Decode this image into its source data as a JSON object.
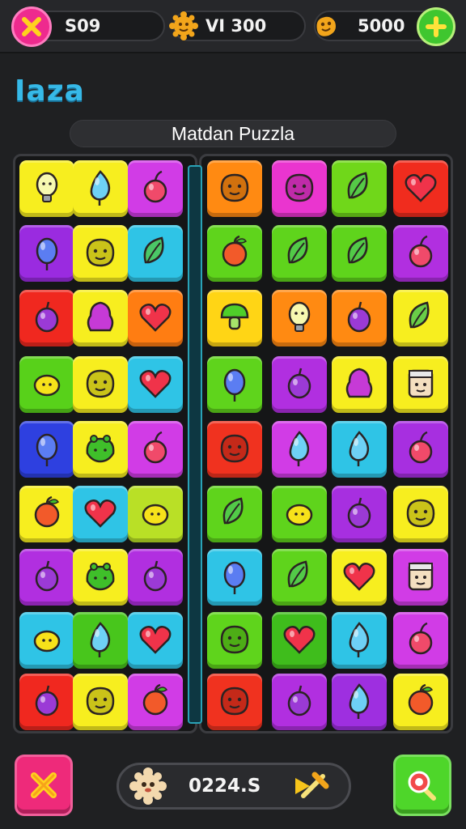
{
  "topbar": {
    "close_button_icon": "x-icon",
    "lives_value": "S09",
    "coins_icon": "sun-coin-icon",
    "coins_value": "VI 300",
    "gems_icon": "bean-icon",
    "gems_value": "5000",
    "add_button_icon": "plus-icon",
    "colors": {
      "close_bg": "#ee2a8e",
      "close_icon": "#ffd21e",
      "add_bg": "#3fc62f",
      "add_icon": "#ffe23a",
      "coin": "#f2a51b"
    }
  },
  "logo": "Іaza",
  "level_title": "Matdan Puzzla",
  "board": {
    "left_columns": 3,
    "right_columns": 4,
    "rows": 9,
    "tiles": [
      [
        "#f7ee1f",
        "#f7ee1f",
        "#d13ce6",
        "#ff8a12",
        "#ea35cf",
        "#70d71a",
        "#f02c1e"
      ],
      [
        "#9a2be0",
        "#f7ee1f",
        "#2fc4e6",
        "#5fd41c",
        "#5fd41c",
        "#5fd41c",
        "#b12fe0"
      ],
      [
        "#f0281f",
        "#f7ee1f",
        "#ff7d12",
        "#ffd515",
        "#ff8a12",
        "#ff8a12",
        "#f7ee1f"
      ],
      [
        "#58d11a",
        "#f7ee1f",
        "#2fc4e6",
        "#5fd41c",
        "#b12fe0",
        "#f7ee1f",
        "#f7ee1f"
      ],
      [
        "#2e40e0",
        "#f7ee1f",
        "#d13ce6",
        "#f0321f",
        "#d13ce6",
        "#2fc4e6",
        "#a72fe0"
      ],
      [
        "#f7ee1f",
        "#2fc4e6",
        "#b9e026",
        "#5fd41c",
        "#5fd41c",
        "#a72fe0",
        "#f7ee1f"
      ],
      [
        "#b12fe0",
        "#f7ee1f",
        "#b12fe0",
        "#2fc4e6",
        "#5fd41c",
        "#f7ee1f",
        "#d13ce6"
      ],
      [
        "#2fc4e6",
        "#48c61c",
        "#2fc4e6",
        "#5fd41c",
        "#3fbd1c",
        "#2fc4e6",
        "#d13ce6"
      ],
      [
        "#f0281f",
        "#f7ee1f",
        "#d13ce6",
        "#f0321f",
        "#b12fe0",
        "#9e2fe0",
        "#f7ee1f"
      ]
    ],
    "icons": [
      [
        "bulb-icon",
        "drop-icon",
        "cherry-icon",
        "face-icon",
        "face-icon",
        "leaf-icon",
        "heart-icon"
      ],
      [
        "balloon-icon",
        "face-icon",
        "leaf-icon",
        "apple-icon",
        "leaf-icon",
        "leaf-icon",
        "cherry-icon"
      ],
      [
        "plum-icon",
        "blob-icon",
        "heart-icon",
        "mushroom-icon",
        "bulb-icon",
        "plum-icon",
        "leaf-icon"
      ],
      [
        "lemon-icon",
        "face-icon",
        "heart-icon",
        "balloon-icon",
        "plum-icon",
        "blob-icon",
        "robot-icon"
      ],
      [
        "balloon-icon",
        "frog-icon",
        "cherry-icon",
        "face-icon",
        "drop-icon",
        "drop-icon",
        "cherry-icon"
      ],
      [
        "apple-icon",
        "heart-icon",
        "lemon-icon",
        "leaf-icon",
        "lemon-icon",
        "plum-icon",
        "face-icon"
      ],
      [
        "plum-icon",
        "frog-icon",
        "plum-icon",
        "balloon-icon",
        "leaf-icon",
        "heart-icon",
        "robot-icon"
      ],
      [
        "lemon-icon",
        "drop-icon",
        "heart-icon",
        "face-icon",
        "heart-icon",
        "drop-icon",
        "cherry-icon"
      ],
      [
        "plum-icon",
        "face-icon",
        "apple-icon",
        "face-icon",
        "plum-icon",
        "drop-icon",
        "apple-icon"
      ]
    ]
  },
  "bottombar": {
    "left_button_icon": "x-icon",
    "score_icon": "cookie-icon",
    "score_value": "0224.S",
    "score_end_icon": "hammer-icon",
    "right_button_icon": "magnifier-icon",
    "colors": {
      "left_bg": "#ee2a7a",
      "right_bg": "#4ed62a"
    }
  }
}
